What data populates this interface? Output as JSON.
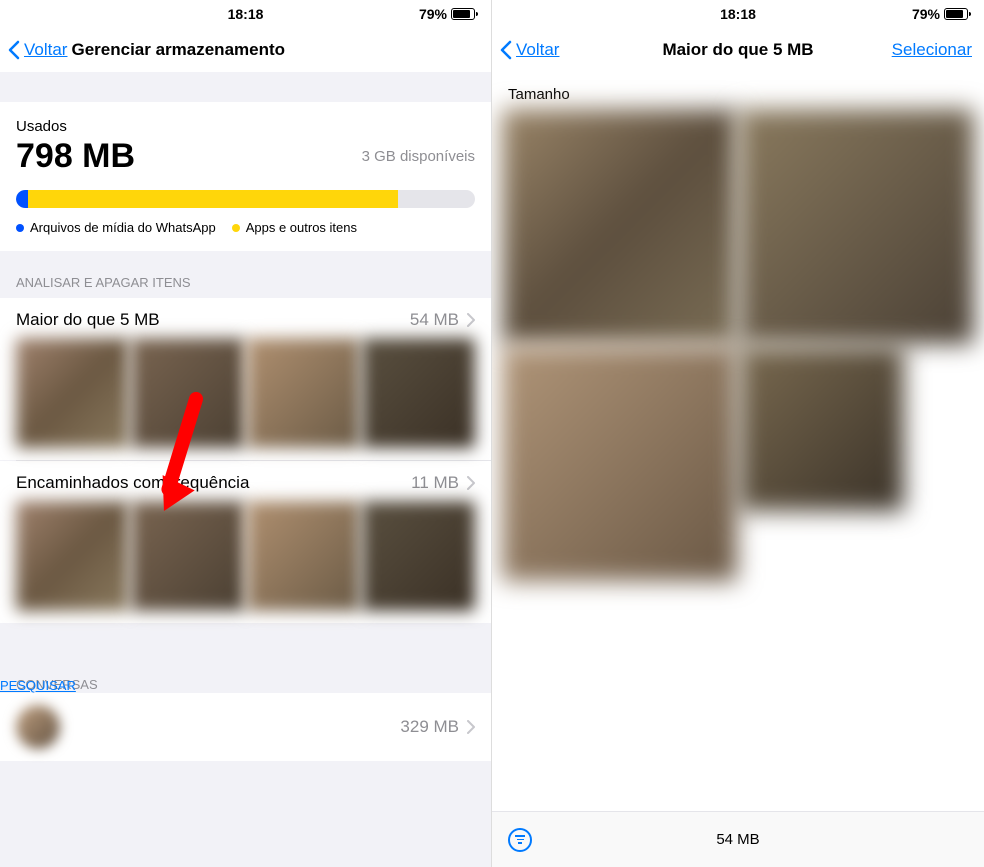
{
  "status": {
    "time": "18:18",
    "battery": "79%"
  },
  "left": {
    "back": "Voltar",
    "title": "Gerenciar armazenamento",
    "used_label": "Usados",
    "used_size": "798 MB",
    "available": "3 GB disponíveis",
    "legend": {
      "whatsapp": "Arquivos de mídia do WhatsApp",
      "apps": "Apps e outros itens"
    },
    "review_header": "ANALISAR E APAGAR ITENS",
    "items": [
      {
        "title": "Maior do que 5 MB",
        "size": "54 MB"
      },
      {
        "title": "Encaminhados com frequência",
        "size": "11 MB"
      }
    ],
    "conversations_header": "CONVERSAS",
    "search": "PESQUISAR",
    "conversation_size": "329 MB"
  },
  "right": {
    "back": "Voltar",
    "title": "Maior do que 5 MB",
    "select": "Selecionar",
    "size_label": "Tamanho",
    "bottom_size": "54 MB"
  }
}
